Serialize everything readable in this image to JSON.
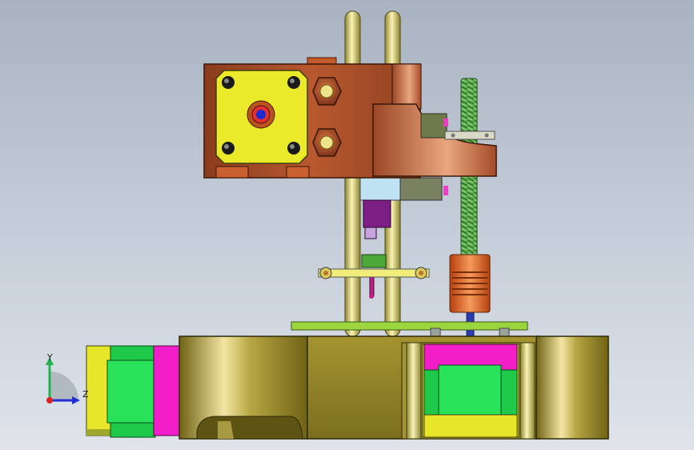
{
  "viewport": {
    "background_top": "#a9b3c1",
    "background_bottom": "#dfe4ea"
  },
  "triad": {
    "y_label": "Y",
    "z_label": "Z",
    "x_color": "#e02020",
    "y_color": "#22b14c",
    "z_color": "#2030d0"
  },
  "colors": {
    "base_bronze": "#9a8a2e",
    "upper_copper": "#b0532d",
    "rod_gold": "#d8cf6e",
    "plate_yellow": "#e6e62a",
    "motor_green": "#22dd55",
    "motor_magenta": "#f020c8",
    "leadscrew_green": "#6fbf5e",
    "coupling_orange": "#e4641c",
    "platform_lime": "#96d23c"
  }
}
